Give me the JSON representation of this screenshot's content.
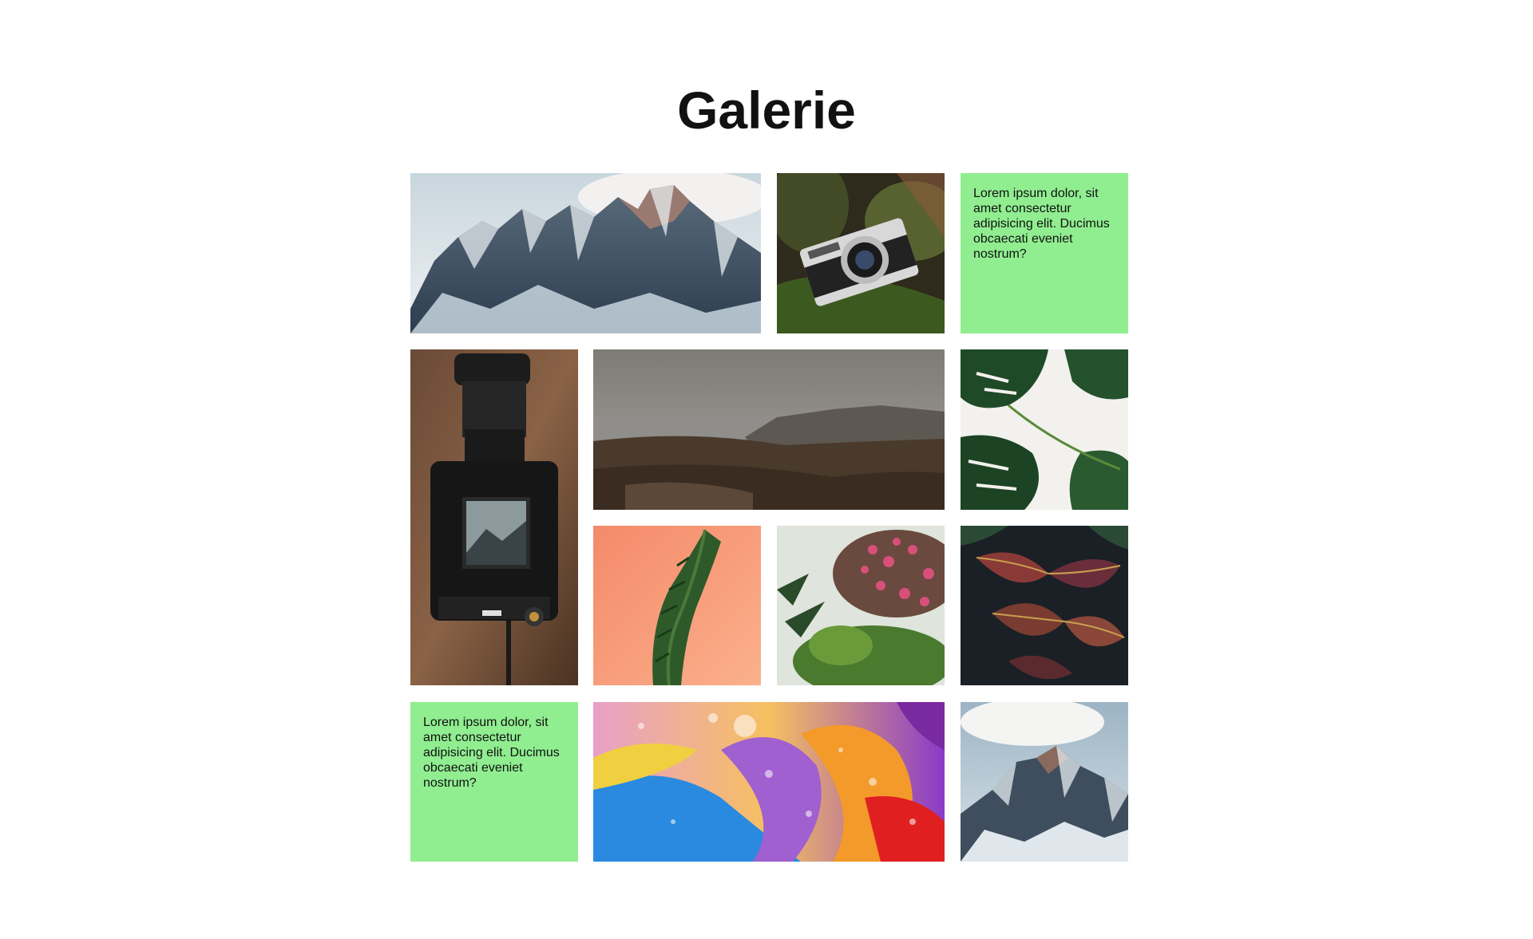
{
  "gallery": {
    "title": "Galerie",
    "text_tile_color": "#90ee90",
    "tiles": [
      {
        "kind": "image",
        "subject": "snowy mountain range"
      },
      {
        "kind": "image",
        "subject": "olympus camera on moss"
      },
      {
        "kind": "text",
        "text": "Lorem ipsum dolor, sit amet consectetur adipisicing elit. Ducimus obcaecati eveniet nostrum?"
      },
      {
        "kind": "image",
        "subject": "medium format camera"
      },
      {
        "kind": "image",
        "subject": "foggy coastline"
      },
      {
        "kind": "image",
        "subject": "monstera leaves"
      },
      {
        "kind": "image",
        "subject": "plant branch on coral background"
      },
      {
        "kind": "image",
        "subject": "pink flowering bush"
      },
      {
        "kind": "image",
        "subject": "croton leaves"
      },
      {
        "kind": "text",
        "text": "Lorem ipsum dolor, sit amet consectetur adipisicing elit. Ducimus obcaecati eveniet nostrum?"
      },
      {
        "kind": "image",
        "subject": "colorful oil bubbles"
      },
      {
        "kind": "image",
        "subject": "snowy mountain peak"
      }
    ]
  }
}
